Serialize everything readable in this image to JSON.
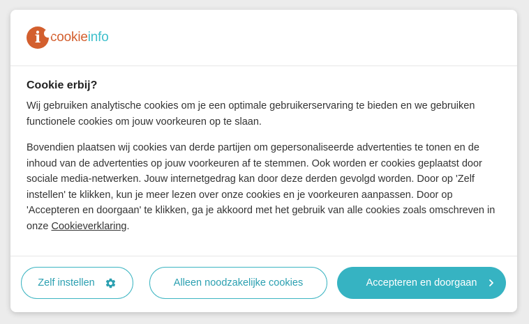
{
  "logo": {
    "text_part1": "cookie",
    "text_part2": "info",
    "mark_letter": "i"
  },
  "dialog": {
    "title": "Cookie erbij?",
    "paragraph1": "Wij gebruiken analytische cookies om je een optimale gebruikerservaring te bieden en we gebruiken functionele cookies om jouw voorkeuren op te slaan.",
    "paragraph2": "Bovendien plaatsen wij cookies van derde partijen om gepersonaliseerde advertenties te tonen en de inhoud van de advertenties op jouw voorkeuren af te stemmen. Ook worden er cookies geplaatst door sociale media-netwerken. Jouw internetgedrag kan door deze derden gevolgd worden. Door op 'Zelf instellen' te klikken, kun je meer lezen over onze cookies en je voorkeuren aanpassen. Door op 'Accepteren en doorgaan' te klikken, ga je akkoord met het gebruik van alle cookies zoals omschreven in onze ",
    "link_text": "Cookieverklaring",
    "paragraph2_end": "."
  },
  "buttons": {
    "self_settings": "Zelf instellen",
    "only_necessary": "Alleen noodzakelijke cookies",
    "accept": "Accepteren en doorgaan"
  },
  "icons": {
    "self_settings": "gear-icon",
    "accept": "chevron-right-icon"
  },
  "colors": {
    "brand_orange": "#d35f2e",
    "brand_teal": "#3dbfcb",
    "button_teal": "#36b3c2"
  }
}
